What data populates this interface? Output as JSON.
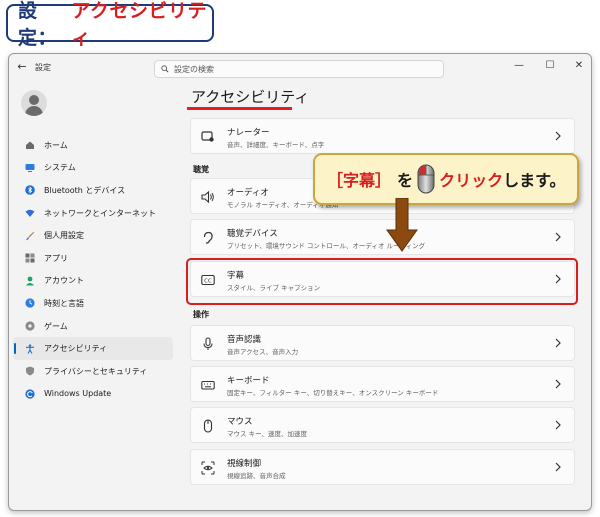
{
  "banner": {
    "prefix": "設定：",
    "title": "アクセシビリティ"
  },
  "window": {
    "app_title": "設定",
    "search_placeholder": "設定の検索",
    "controls": {
      "back": "←",
      "minimize": "—",
      "maximize": "☐",
      "close": "✕"
    }
  },
  "sidebar": {
    "items": [
      {
        "label": "ホーム",
        "icon": "home-icon",
        "color": "#5a5a5a"
      },
      {
        "label": "システム",
        "icon": "monitor-icon",
        "color": "#2b7de0"
      },
      {
        "label": "Bluetooth とデバイス",
        "icon": "bluetooth-icon",
        "color": "#1f6fd6"
      },
      {
        "label": "ネットワークとインターネット",
        "icon": "wifi-icon",
        "color": "#2f6fd6"
      },
      {
        "label": "個人用設定",
        "icon": "brush-icon",
        "color": "#d27a2a"
      },
      {
        "label": "アプリ",
        "icon": "apps-icon",
        "color": "#5a5a5a"
      },
      {
        "label": "アカウント",
        "icon": "account-icon",
        "color": "#22a06b"
      },
      {
        "label": "時刻と言語",
        "icon": "time-language-icon",
        "color": "#2f7de0"
      },
      {
        "label": "ゲーム",
        "icon": "gamepad-icon",
        "color": "#7a7a7a"
      },
      {
        "label": "アクセシビリティ",
        "icon": "accessibility-icon",
        "color": "#1f6fd6",
        "active": true
      },
      {
        "label": "プライバシーとセキュリティ",
        "icon": "shield-icon",
        "color": "#7a7a7a"
      },
      {
        "label": "Windows Update",
        "icon": "update-icon",
        "color": "#1f6fd6"
      }
    ]
  },
  "main": {
    "title": "アクセシビリティ",
    "sections": {
      "hearing": "聴覚",
      "interaction": "操作"
    },
    "cards": {
      "narrator": {
        "title": "ナレーター",
        "subtitle": "音声、詳細度、キーボード、点字",
        "icon": "narrator-icon"
      },
      "audio": {
        "title": "オーディオ",
        "subtitle": "モノラル オーディオ、オーディオ通知",
        "icon": "speaker-icon"
      },
      "hearing_devices": {
        "title": "聴覚デバイス",
        "subtitle": "プリセット、環境サウンド コントロール、オーディオ ルーティング",
        "icon": "ear-icon"
      },
      "captions": {
        "title": "字幕",
        "subtitle": "スタイル、ライブ キャプション",
        "icon": "cc-icon"
      },
      "speech": {
        "title": "音声認識",
        "subtitle": "音声アクセス、音声入力",
        "icon": "microphone-icon"
      },
      "keyboard": {
        "title": "キーボード",
        "subtitle": "固定キー、フィルター キー、切り替えキー、オンスクリーン キーボード",
        "icon": "keyboard-icon"
      },
      "mouse": {
        "title": "マウス",
        "subtitle": "マウス キー、速度、加速度",
        "icon": "mouse-icon"
      },
      "eye_control": {
        "title": "視線制御",
        "subtitle": "視線追跡、音声合成",
        "icon": "eye-control-icon"
      }
    }
  },
  "callout": {
    "open_bracket": "［",
    "target": "字幕",
    "close_bracket": "］",
    "particle": "を",
    "action": "クリック",
    "rest": "します。"
  },
  "colors": {
    "accent": "#0067c0",
    "highlight": "#d61e1e",
    "banner_blue": "#1f3a7a",
    "callout_bg": "#fdf3c8",
    "arrow": "#8b4a10"
  }
}
